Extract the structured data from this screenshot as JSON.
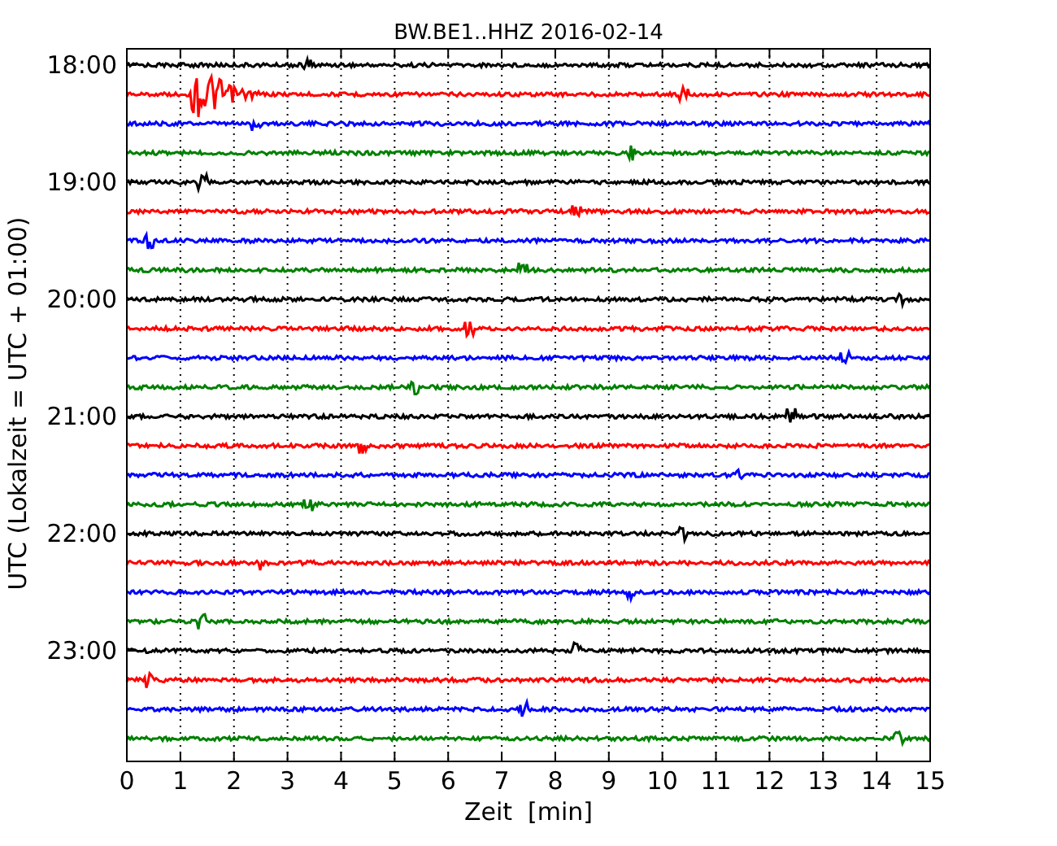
{
  "plot": {
    "title": "BW.BE1..HHZ 2016-02-14",
    "xlabel": "Zeit  [min]",
    "ylabel": "UTC (Lokalzeit = UTC + 01:00)",
    "xticks": [
      "0",
      "1",
      "2",
      "3",
      "4",
      "5",
      "6",
      "7",
      "8",
      "9",
      "10",
      "11",
      "12",
      "13",
      "14",
      "15"
    ],
    "yticks": [
      "18:00",
      "19:00",
      "20:00",
      "21:00",
      "22:00",
      "23:00"
    ],
    "traces": [
      {
        "color": "#000000"
      },
      {
        "color": "#ff0000"
      },
      {
        "color": "#0000ff"
      },
      {
        "color": "#008000"
      },
      {
        "color": "#000000"
      },
      {
        "color": "#ff0000"
      },
      {
        "color": "#0000ff"
      },
      {
        "color": "#008000"
      },
      {
        "color": "#000000"
      },
      {
        "color": "#ff0000"
      },
      {
        "color": "#0000ff"
      },
      {
        "color": "#008000"
      },
      {
        "color": "#000000"
      },
      {
        "color": "#ff0000"
      },
      {
        "color": "#0000ff"
      },
      {
        "color": "#008000"
      },
      {
        "color": "#000000"
      },
      {
        "color": "#ff0000"
      },
      {
        "color": "#0000ff"
      },
      {
        "color": "#008000"
      },
      {
        "color": "#000000"
      },
      {
        "color": "#ff0000"
      },
      {
        "color": "#0000ff"
      },
      {
        "color": "#008000"
      }
    ]
  }
}
